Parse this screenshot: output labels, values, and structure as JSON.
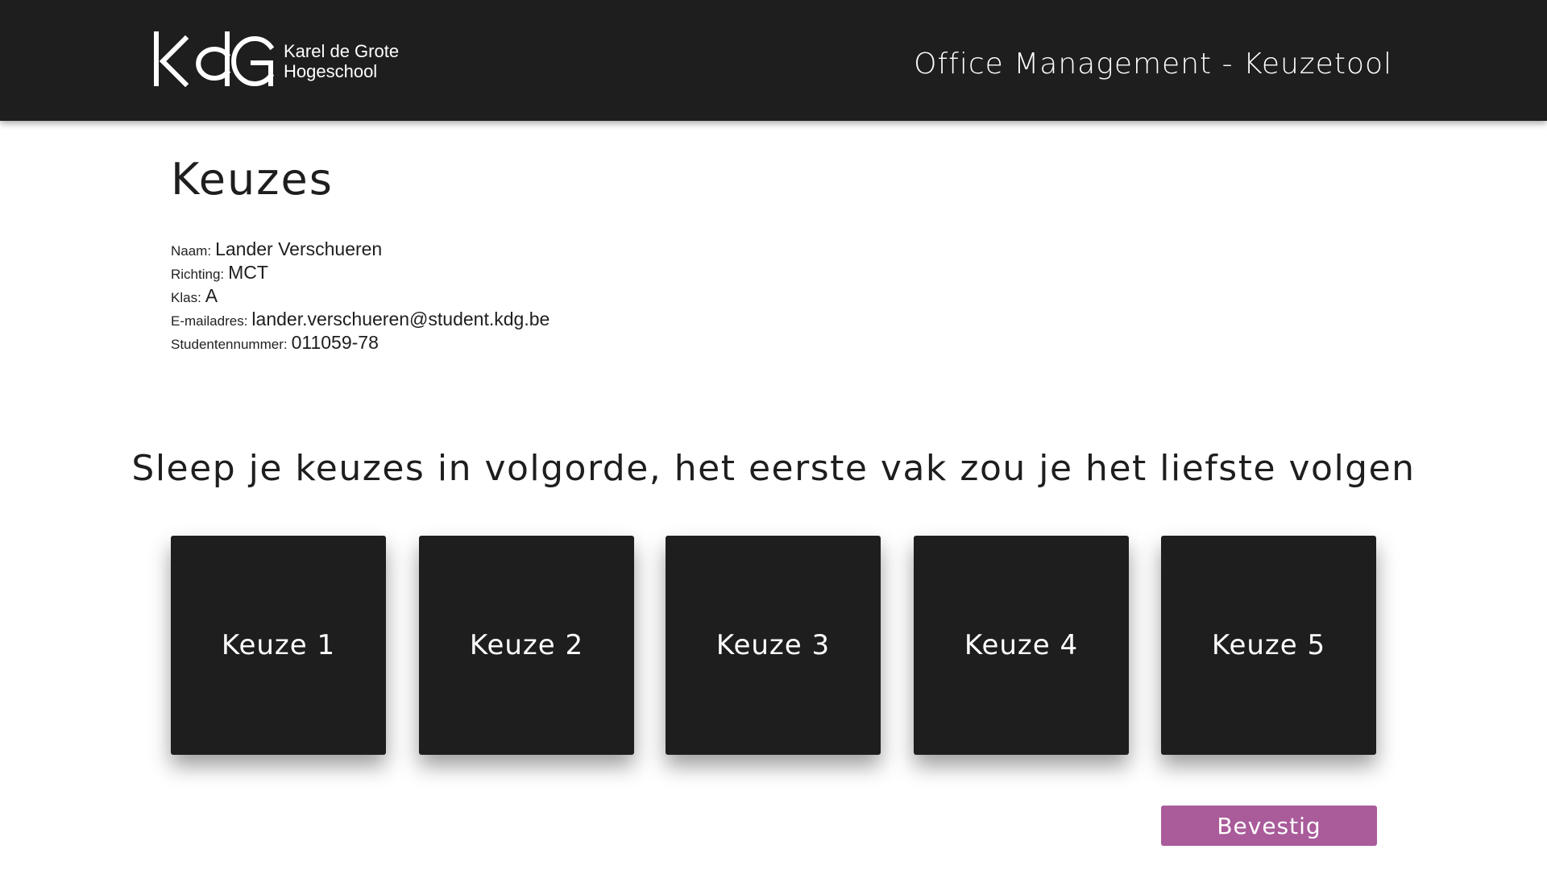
{
  "header": {
    "logo": {
      "mark": "KdG",
      "line1": "Karel de Grote",
      "line2": "Hogeschool"
    },
    "title": "Office Management - Keuzetool"
  },
  "page": {
    "heading": "Keuzes"
  },
  "student": {
    "name_label": "Naam:",
    "name": "Lander Verschueren",
    "direction_label": "Richting:",
    "direction": "MCT",
    "class_label": "Klas:",
    "class": "A",
    "email_label": "E-mailadres:",
    "email": "lander.verschueren@student.kdg.be",
    "number_label": "Studentennummer:",
    "number": "011059-78"
  },
  "instruction": "Sleep je keuzes in volgorde, het eerste vak zou je het liefste volgen",
  "choices": [
    {
      "label": "Keuze 1"
    },
    {
      "label": "Keuze 2"
    },
    {
      "label": "Keuze 3"
    },
    {
      "label": "Keuze 4"
    },
    {
      "label": "Keuze 5"
    }
  ],
  "confirm_label": "Bevestig",
  "colors": {
    "header_bg": "#1e1e1e",
    "card_bg": "#1e1e1e",
    "accent": "#a95b9a",
    "text": "#1e1e1e"
  }
}
